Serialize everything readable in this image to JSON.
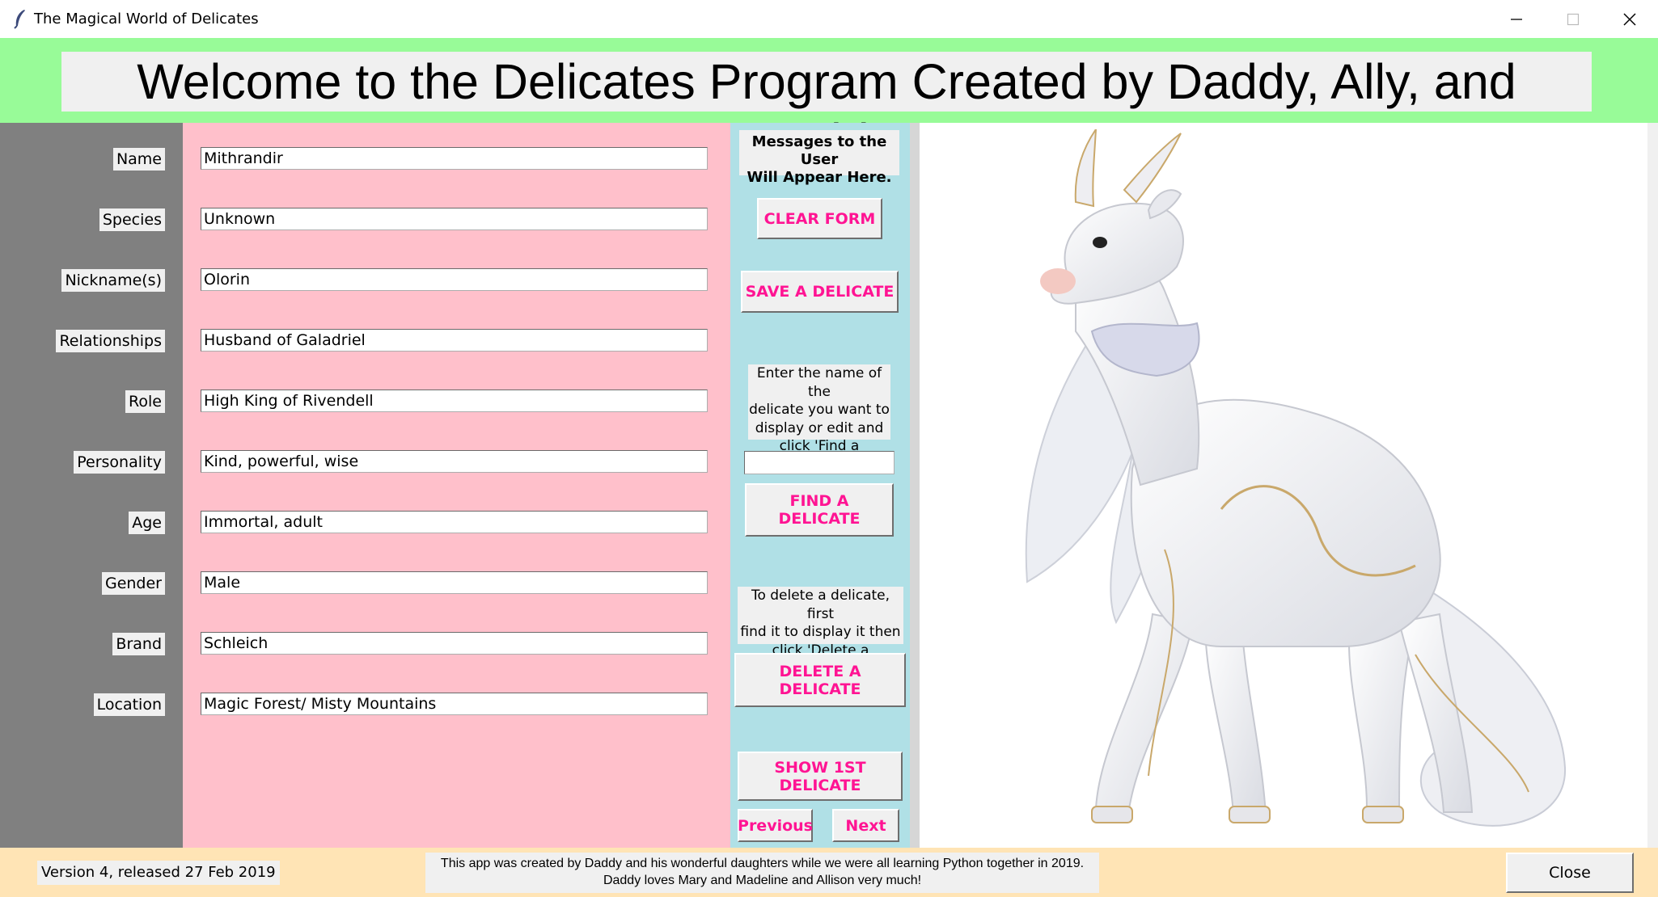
{
  "window": {
    "title": "The Magical World of Delicates",
    "icons": {
      "app": "feather-icon",
      "minimize": "minimize-icon",
      "maximize": "maximize-icon",
      "close": "close-icon"
    }
  },
  "header": {
    "welcome": "Welcome to the Delicates Program Created by Daddy, Ally, and Maddy!"
  },
  "form": {
    "fields": [
      {
        "label": "Name",
        "value": "Mithrandir"
      },
      {
        "label": "Species",
        "value": "Unknown"
      },
      {
        "label": "Nickname(s)",
        "value": "Olorin"
      },
      {
        "label": "Relationships",
        "value": "Husband of Galadriel"
      },
      {
        "label": "Role",
        "value": "High King of Rivendell"
      },
      {
        "label": "Personality",
        "value": "Kind, powerful, wise"
      },
      {
        "label": "Age",
        "value": "Immortal, adult"
      },
      {
        "label": "Gender",
        "value": "Male"
      },
      {
        "label": "Brand",
        "value": "Schleich"
      },
      {
        "label": "Location",
        "value": "Magic Forest/ Misty Mountains"
      }
    ]
  },
  "controls": {
    "messages_line1": "Messages to the User",
    "messages_line2": "Will Appear Here.",
    "clear_form": "CLEAR FORM",
    "save": "SAVE A DELICATE",
    "find_instructions": [
      "Enter the name of the",
      "delicate you want to",
      "display or edit and",
      "click 'Find a Delicate':"
    ],
    "find_value": "",
    "find": "FIND A DELICATE",
    "delete_instructions": [
      "To delete a delicate, first",
      "find it to display it then",
      "click 'Delete a Delicate':"
    ],
    "delete": "DELETE A DELICATE",
    "show_first": "SHOW 1ST DELICATE",
    "previous": "Previous",
    "next": "Next"
  },
  "colors": {
    "banner": "#98fb98",
    "labels_panel": "#808080",
    "fields_panel": "#ffc0cb",
    "controls_panel": "#b0e0e6",
    "footer": "#ffe4b5",
    "button_text": "#ff1493"
  },
  "image": {
    "subject": "white unicorn-like creature figurine"
  },
  "footer": {
    "version": "Version 4, released 27 Feb 2019",
    "credits_line1": "This app was created by Daddy and his wonderful daughters while we were all learning Python together in 2019.",
    "credits_line2": "Daddy loves Mary and Madeline and Allison very much!",
    "close": "Close"
  }
}
